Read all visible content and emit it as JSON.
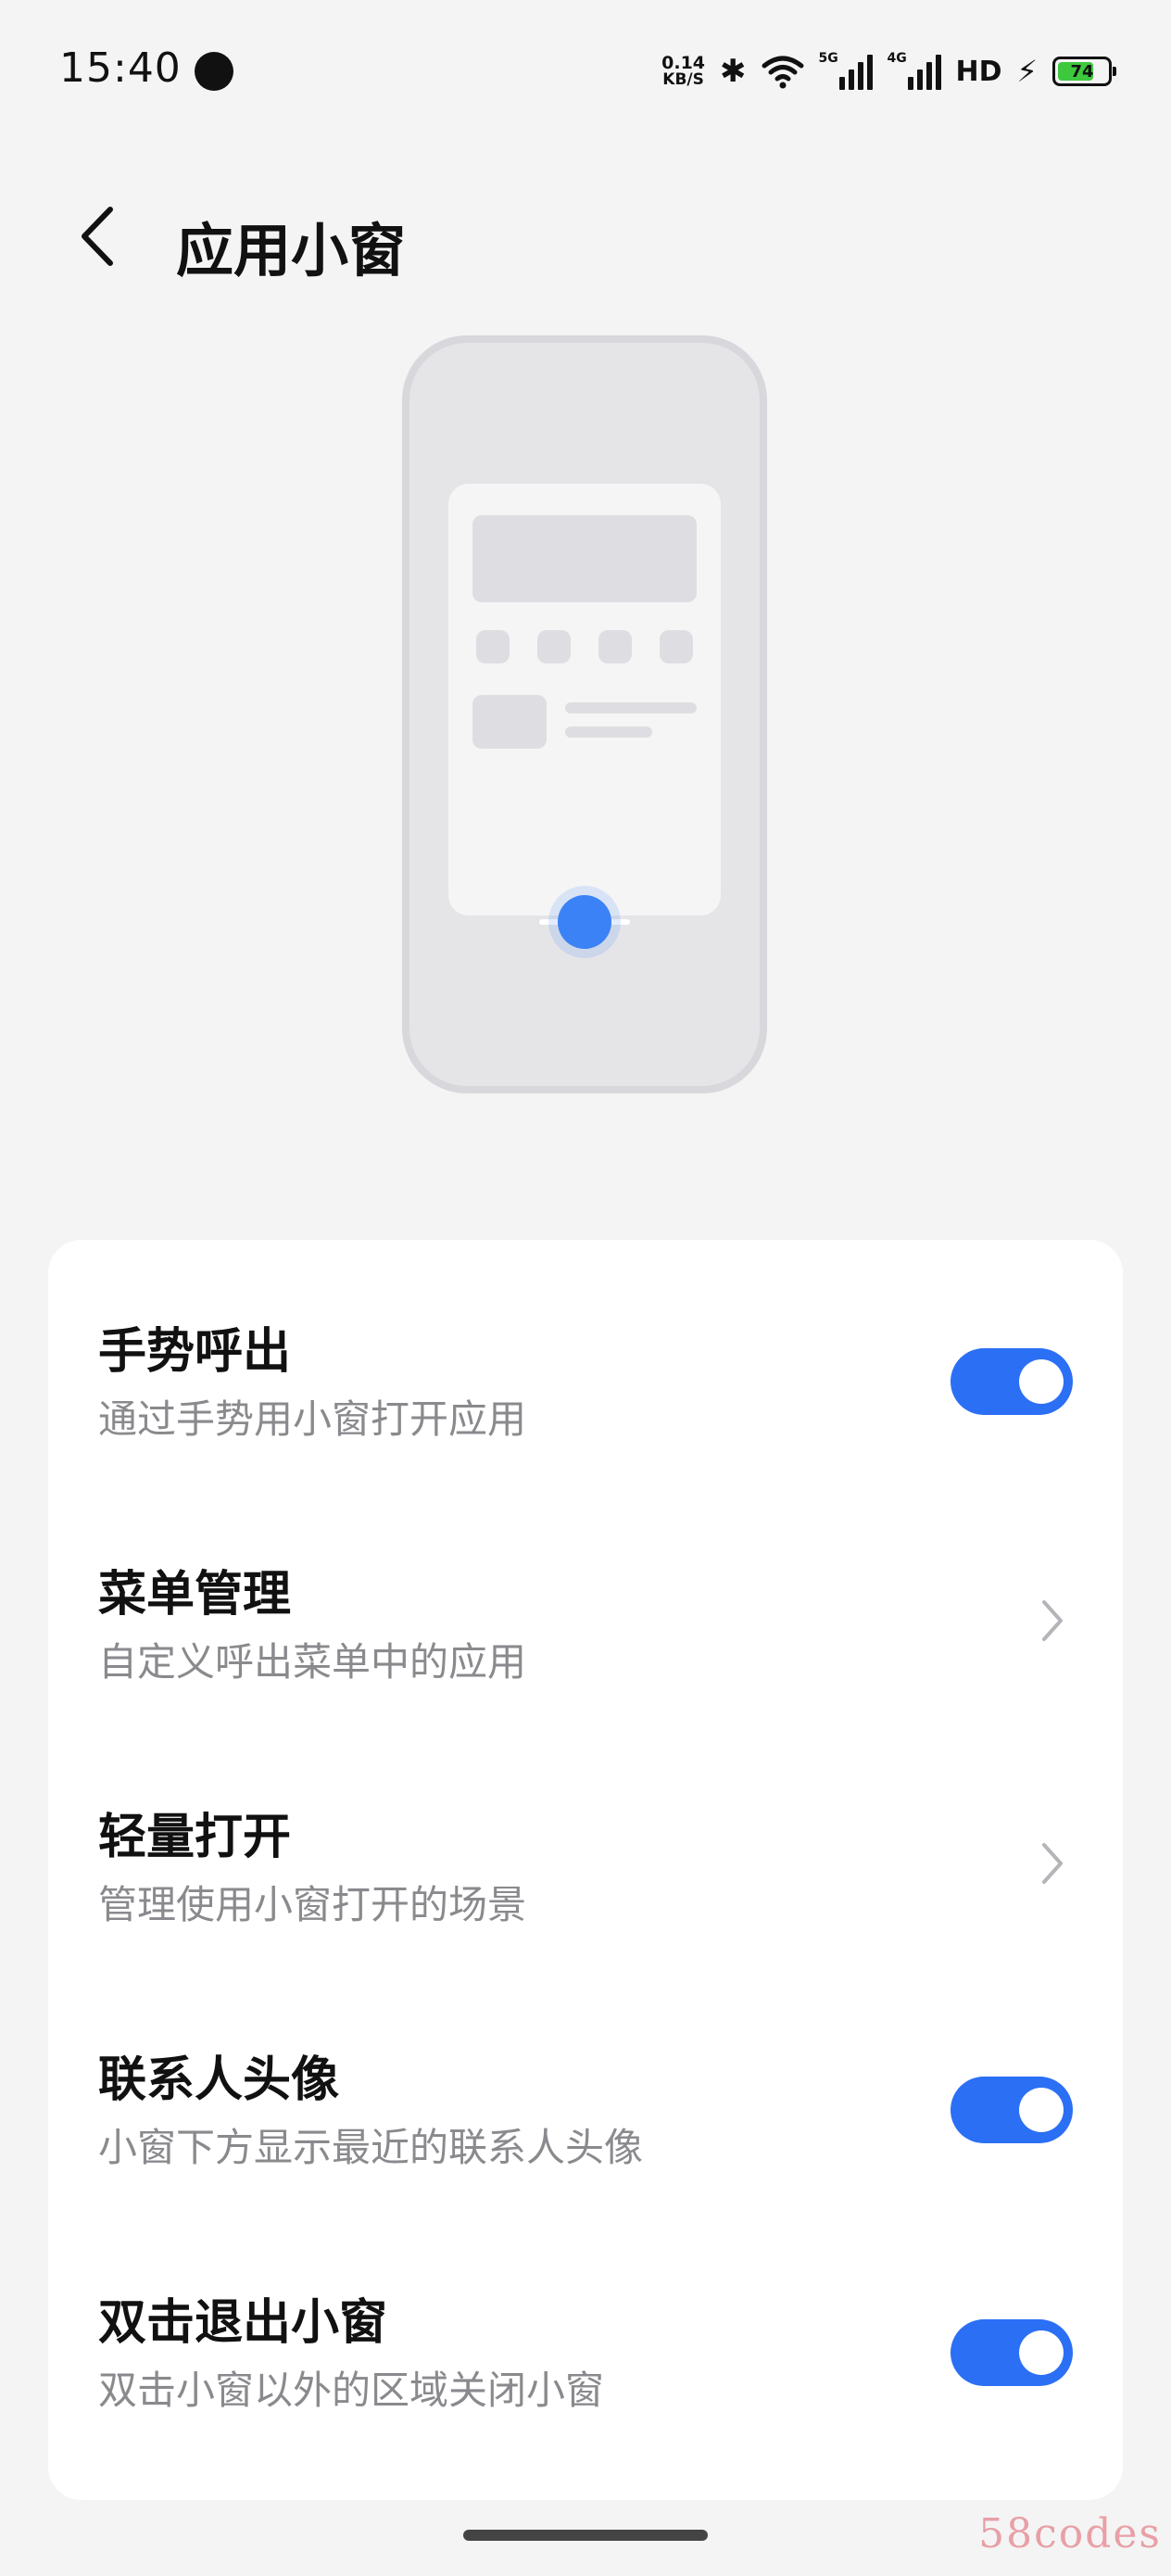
{
  "status_bar": {
    "time": "15:40",
    "net_speed_value": "0.14",
    "net_speed_unit": "KB/S",
    "bluetooth_icon": "✱",
    "sim1_type": "5G",
    "sim2_type": "4G",
    "hd_label": "HD",
    "battery_level": "74",
    "battery_fraction": 0.74,
    "charging": true
  },
  "header": {
    "back_icon": "chevron-left-icon",
    "title": "应用小窗"
  },
  "illustration": {
    "accent_color": "#3a82f6"
  },
  "settings": {
    "items": [
      {
        "title": "手势呼出",
        "subtitle": "通过手势用小窗打开应用",
        "control": "toggle",
        "enabled": true
      },
      {
        "title": "菜单管理",
        "subtitle": "自定义呼出菜单中的应用",
        "control": "chevron"
      },
      {
        "title": "轻量打开",
        "subtitle": "管理使用小窗打开的场景",
        "control": "chevron"
      },
      {
        "title": "联系人头像",
        "subtitle": "小窗下方显示最近的联系人头像",
        "control": "toggle",
        "enabled": true
      },
      {
        "title": "双击退出小窗",
        "subtitle": "双击小窗以外的区域关闭小窗",
        "control": "toggle",
        "enabled": true
      }
    ]
  },
  "colors": {
    "toggle_on": "#2b6ff5",
    "background": "#f4f4f5",
    "card": "#ffffff"
  },
  "watermark": "58codes"
}
